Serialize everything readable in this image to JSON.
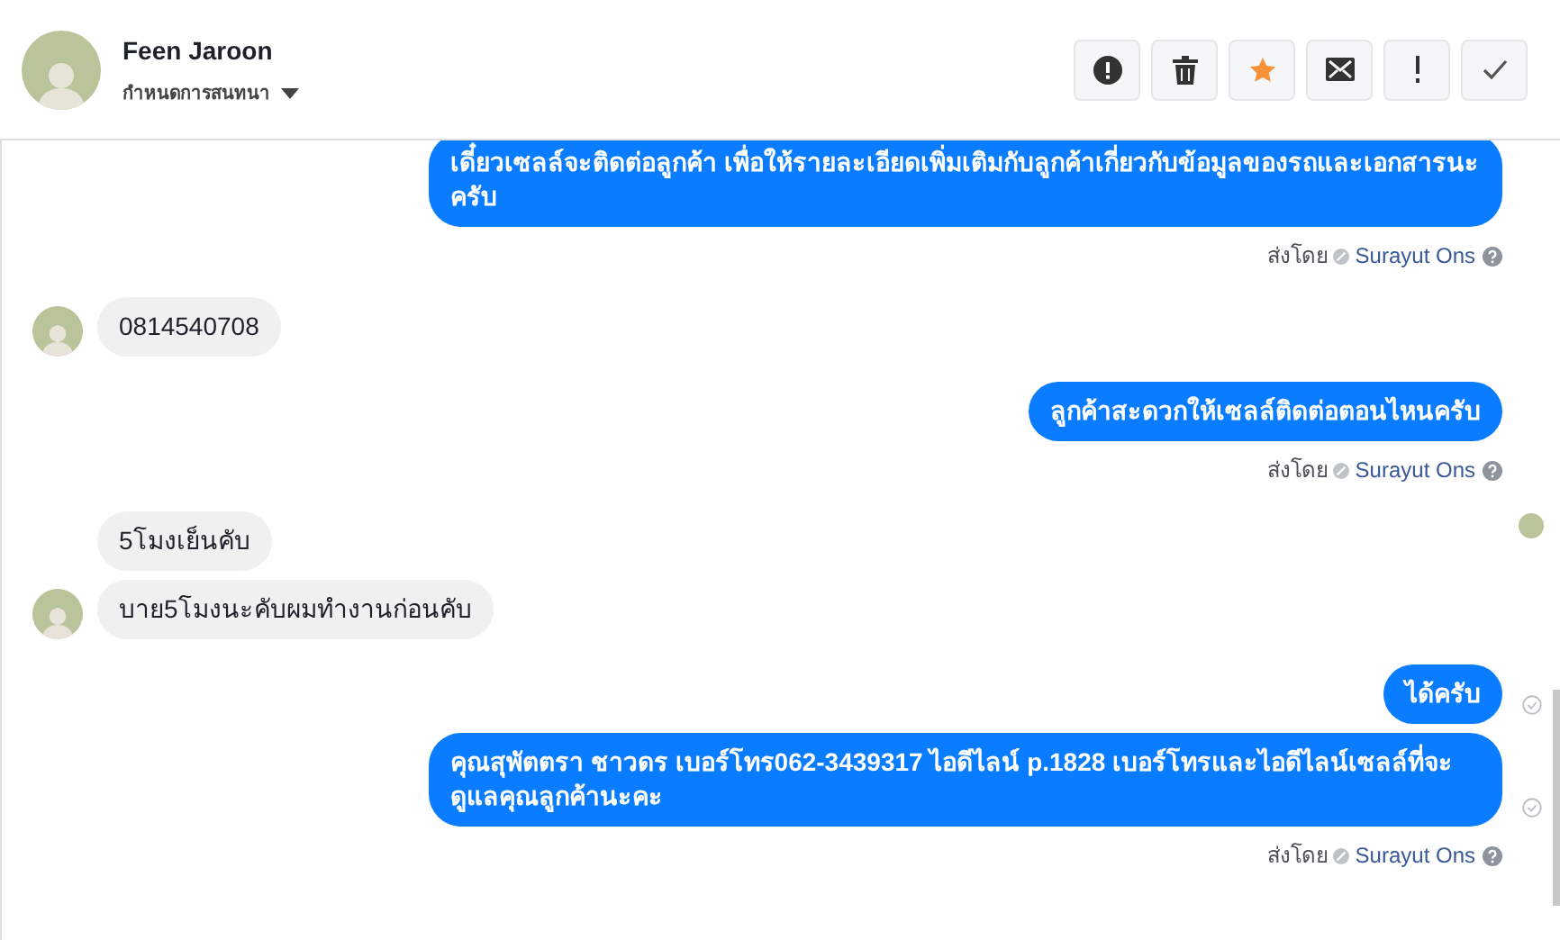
{
  "contact": {
    "name": "Feen Jaroon",
    "subtitle": "กำหนดการสนทนา"
  },
  "toolbar": [
    {
      "kind": "spam",
      "on": false
    },
    {
      "kind": "delete",
      "on": false
    },
    {
      "kind": "star",
      "on": true
    },
    {
      "kind": "unread",
      "on": false
    },
    {
      "kind": "important",
      "on": false
    },
    {
      "kind": "done",
      "on": false
    }
  ],
  "messages": [
    {
      "kind": "outgoing",
      "text": "เดี๋ยวเซลล์จะติดต่อลูกค้า เพื่อให้รายละเอียดเพิ่มเติมกับลูกค้าเกี่ยวกับข้อมูลของรถและเอกสารนะครับ",
      "sent_by": {
        "label": "ส่งโดย",
        "name": "Surayut Ons"
      }
    },
    {
      "kind": "incoming",
      "text": "0814540708",
      "avatar": true,
      "seen": false
    },
    {
      "kind": "outgoing",
      "text": "ลูกค้าสะดวกให้เซลล์ติดต่อตอนไหนครับ",
      "sent_by": {
        "label": "ส่งโดย",
        "name": "Surayut Ons"
      }
    },
    {
      "kind": "incoming",
      "text": "5โมงเย็นคับ",
      "avatar": false,
      "seen": true
    },
    {
      "kind": "incoming",
      "text": "บาย5โมงนะคับผมทำงานก่อนคับ",
      "avatar": true,
      "seen": false
    },
    {
      "kind": "outgoing",
      "text": "ได้ครับ",
      "delivered": true
    },
    {
      "kind": "outgoing",
      "text": "คุณสุพัตตรา  ชาวดร เบอร์โทร062-3439317 ไอดีไลน์ p.1828  เบอร์โทรและไอดีไลน์เซลล์ที่จะดูแลคุณลูกค้านะคะ",
      "delivered": true,
      "sent_by": {
        "label": "ส่งโดย",
        "name": "Surayut Ons"
      }
    }
  ]
}
